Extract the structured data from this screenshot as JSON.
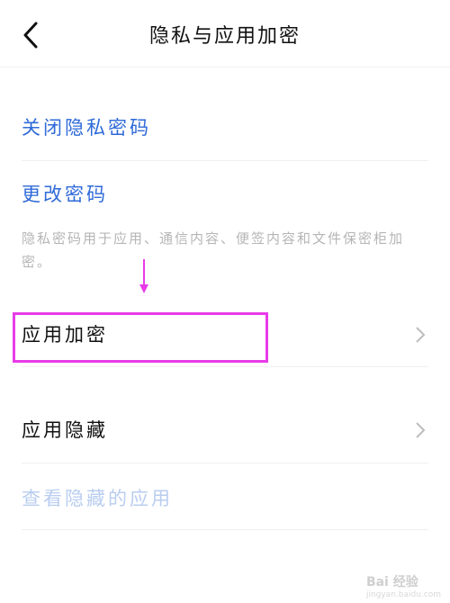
{
  "header": {
    "title": "隐私与应用加密"
  },
  "menu": {
    "close_password": "关闭隐私密码",
    "change_password": "更改密码",
    "description": "隐私密码用于应用、通信内容、便签内容和文件保密柜加密。",
    "app_encryption": "应用加密",
    "app_hide": "应用隐藏",
    "view_hidden": "查看隐藏的应用"
  },
  "watermark": {
    "brand": "Bai 经验",
    "sub": "jingyan.baidu.com"
  },
  "colors": {
    "link_blue": "#2f6ad8",
    "disabled_blue": "#b9cdf0",
    "highlight": "#e83be8"
  }
}
